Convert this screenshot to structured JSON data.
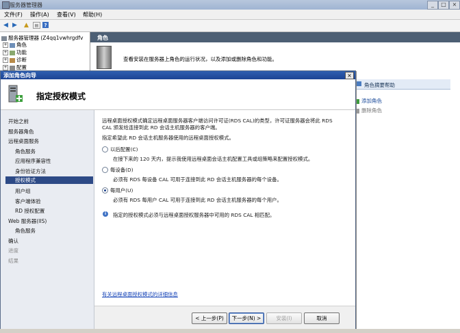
{
  "main_window": {
    "title": "服务器管理器",
    "menu": [
      "文件(F)",
      "操作(A)",
      "查看(V)",
      "帮助(H)"
    ],
    "tree": {
      "root": "服务器管理器 (Z4qq1vwhrgdfv",
      "items": [
        "角色",
        "功能",
        "诊断",
        "配置"
      ]
    },
    "roles_header": "角色",
    "roles_description": "查看安装在服务器上角色的运行状况，以及添加或删除角色和功能。",
    "help_panel": {
      "header": "角色摘要帮助",
      "add_role": "添加角色",
      "remove_role": "删除角色"
    }
  },
  "wizard": {
    "title": "添加角色向导",
    "page_title": "指定授权模式",
    "nav": [
      {
        "label": "开始之前",
        "level": 0,
        "state": "normal"
      },
      {
        "label": "服务器角色",
        "level": 0,
        "state": "normal"
      },
      {
        "label": "远程桌面服务",
        "level": 0,
        "state": "normal"
      },
      {
        "label": "角色服务",
        "level": 1,
        "state": "normal"
      },
      {
        "label": "应用程序兼容性",
        "level": 1,
        "state": "normal"
      },
      {
        "label": "身份验证方法",
        "level": 1,
        "state": "normal"
      },
      {
        "label": "授权模式",
        "level": 1,
        "state": "selected"
      },
      {
        "label": "用户组",
        "level": 1,
        "state": "normal"
      },
      {
        "label": "客户端体验",
        "level": 1,
        "state": "normal"
      },
      {
        "label": "RD 授权配置",
        "level": 1,
        "state": "normal"
      },
      {
        "label": "Web 服务器(IIS)",
        "level": 0,
        "state": "normal"
      },
      {
        "label": "角色服务",
        "level": 1,
        "state": "normal"
      },
      {
        "label": "确认",
        "level": 0,
        "state": "normal"
      },
      {
        "label": "进度",
        "level": 0,
        "state": "disabled"
      },
      {
        "label": "结果",
        "level": 0,
        "state": "disabled"
      }
    ],
    "intro_line1": "远程桌面授权模式确定远程桌面服务器客户端访问许可证(RDS CAL)的类型，许可证服务器会将此 RDS",
    "intro_line2": "CAL 颁发给连接到此 RD 会话主机服务器的客户端。",
    "prompt": "指定希望此 RD 会话主机服务器使用的远程桌面授权模式。",
    "options": [
      {
        "label": "以后配置(C)",
        "desc": "在接下来的 120 天内，提示我使用远程桌面会话主机配置工具或组策略来配置授权模式。",
        "selected": false
      },
      {
        "label": "每设备(D)",
        "desc": "必须有 RDS 每设备 CAL 可用于连接到此 RD 会话主机服务器的每个设备。",
        "selected": false
      },
      {
        "label": "每用户(U)",
        "desc": "必须有 RDS 每用户 CAL 可用于连接到此 RD 会话主机服务器的每个用户。",
        "selected": true
      }
    ],
    "info_text": "指定的授权模式必须与远程桌面授权服务器中可用的 RDS CAL 相匹配。",
    "link_text": "有关远程桌面授权模式的详细信息",
    "buttons": {
      "back": "< 上一步(P)",
      "next": "下一步(N) >",
      "install": "安装(I)",
      "cancel": "取消"
    }
  }
}
